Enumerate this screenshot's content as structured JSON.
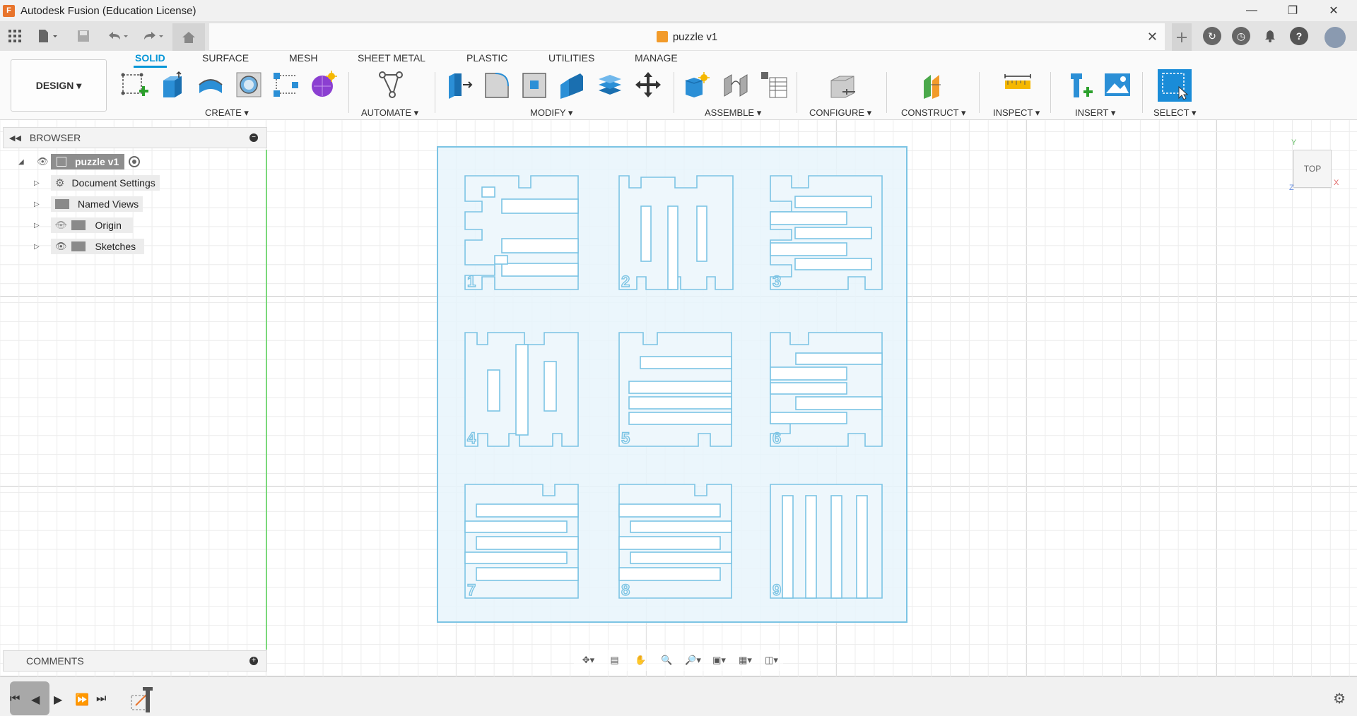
{
  "window": {
    "title": "Autodesk Fusion (Education License)",
    "logo_letter": "F"
  },
  "doc_tab": {
    "name": "puzzle v1"
  },
  "toolbar": {
    "workspace": "DESIGN ▾",
    "tabs": [
      "SOLID",
      "SURFACE",
      "MESH",
      "SHEET METAL",
      "PLASTIC",
      "UTILITIES",
      "MANAGE"
    ],
    "active_tab": "SOLID",
    "groups": [
      "CREATE ▾",
      "AUTOMATE ▾",
      "MODIFY ▾",
      "ASSEMBLE ▾",
      "CONFIGURE ▾",
      "CONSTRUCT ▾",
      "INSPECT ▾",
      "INSERT ▾",
      "SELECT ▾"
    ]
  },
  "browser": {
    "label": "BROWSER",
    "root": "puzzle v1",
    "items": [
      "Document Settings",
      "Named Views",
      "Origin",
      "Sketches"
    ]
  },
  "comments": {
    "label": "COMMENTS"
  },
  "viewcube": {
    "face": "TOP",
    "axis_x": "X",
    "axis_y": "Y",
    "axis_z": "Z"
  },
  "sketch": {
    "piece_numbers": [
      "1",
      "2",
      "3",
      "4",
      "5",
      "6",
      "7",
      "8",
      "9"
    ]
  },
  "colors": {
    "accent": "#0696d7",
    "sketch_line": "#7cc4e4",
    "sketch_fill": "#e8f4fb"
  }
}
